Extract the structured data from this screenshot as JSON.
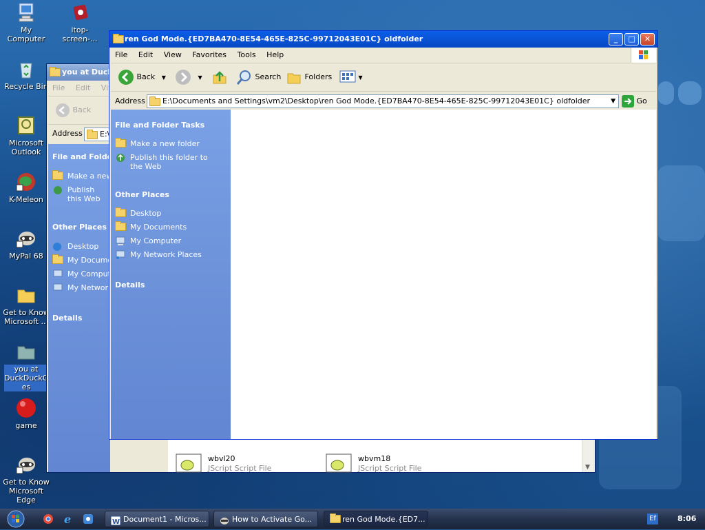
{
  "desktop": {
    "icons": [
      {
        "label": "My Computer"
      },
      {
        "label": "itop-screen-..."
      },
      {
        "label": "Recycle Bin"
      },
      {
        "label": "Microsoft Outlook"
      },
      {
        "label": "K-Meleon"
      },
      {
        "label": "MyPal 68"
      },
      {
        "label": "Get to Know Microsoft ..."
      },
      {
        "label": "you at DuckDuckGo_ es"
      },
      {
        "label": "game"
      },
      {
        "label": "Get to Know Microsoft Edge"
      }
    ]
  },
  "back_window": {
    "title": "you at Duck",
    "menu": [
      "File",
      "Edit",
      "Vi"
    ],
    "back_label": "Back",
    "address_label": "Address",
    "address_value": "E:\\",
    "tasks_heading": "File and Folder",
    "tasks": [
      "Make a new",
      "Publish this Web"
    ],
    "other_heading": "Other Places",
    "other": [
      "Desktop",
      "My Docume",
      "My Comput",
      "My Network"
    ],
    "details_heading": "Details",
    "files": [
      {
        "name": "wbvl20",
        "type": "JScript Script File"
      },
      {
        "name": "wbvm18",
        "type": "JScript Script File"
      }
    ]
  },
  "front_window": {
    "title": "ren God Mode.{ED7BA470-8E54-465E-825C-99712043E01C} oldfolder",
    "menu": [
      "File",
      "Edit",
      "View",
      "Favorites",
      "Tools",
      "Help"
    ],
    "toolbar": {
      "back": "Back",
      "search": "Search",
      "folders": "Folders"
    },
    "address_label": "Address",
    "address_value": "E:\\Documents and Settings\\vm2\\Desktop\\ren God Mode.{ED7BA470-8E54-465E-825C-99712043E01C} oldfolder",
    "go_label": "Go",
    "tasks_heading": "File and Folder Tasks",
    "tasks": [
      "Make a new folder",
      "Publish this folder to the Web"
    ],
    "other_heading": "Other Places",
    "other": [
      "Desktop",
      "My Documents",
      "My Computer",
      "My Network Places"
    ],
    "details_heading": "Details"
  },
  "taskbar": {
    "tasks": [
      {
        "label": "Document1 - Micros..."
      },
      {
        "label": "How to Activate Go..."
      },
      {
        "label": "ren God Mode.{ED7..."
      }
    ],
    "tray_lang": "Ef",
    "clock": "8:06"
  }
}
